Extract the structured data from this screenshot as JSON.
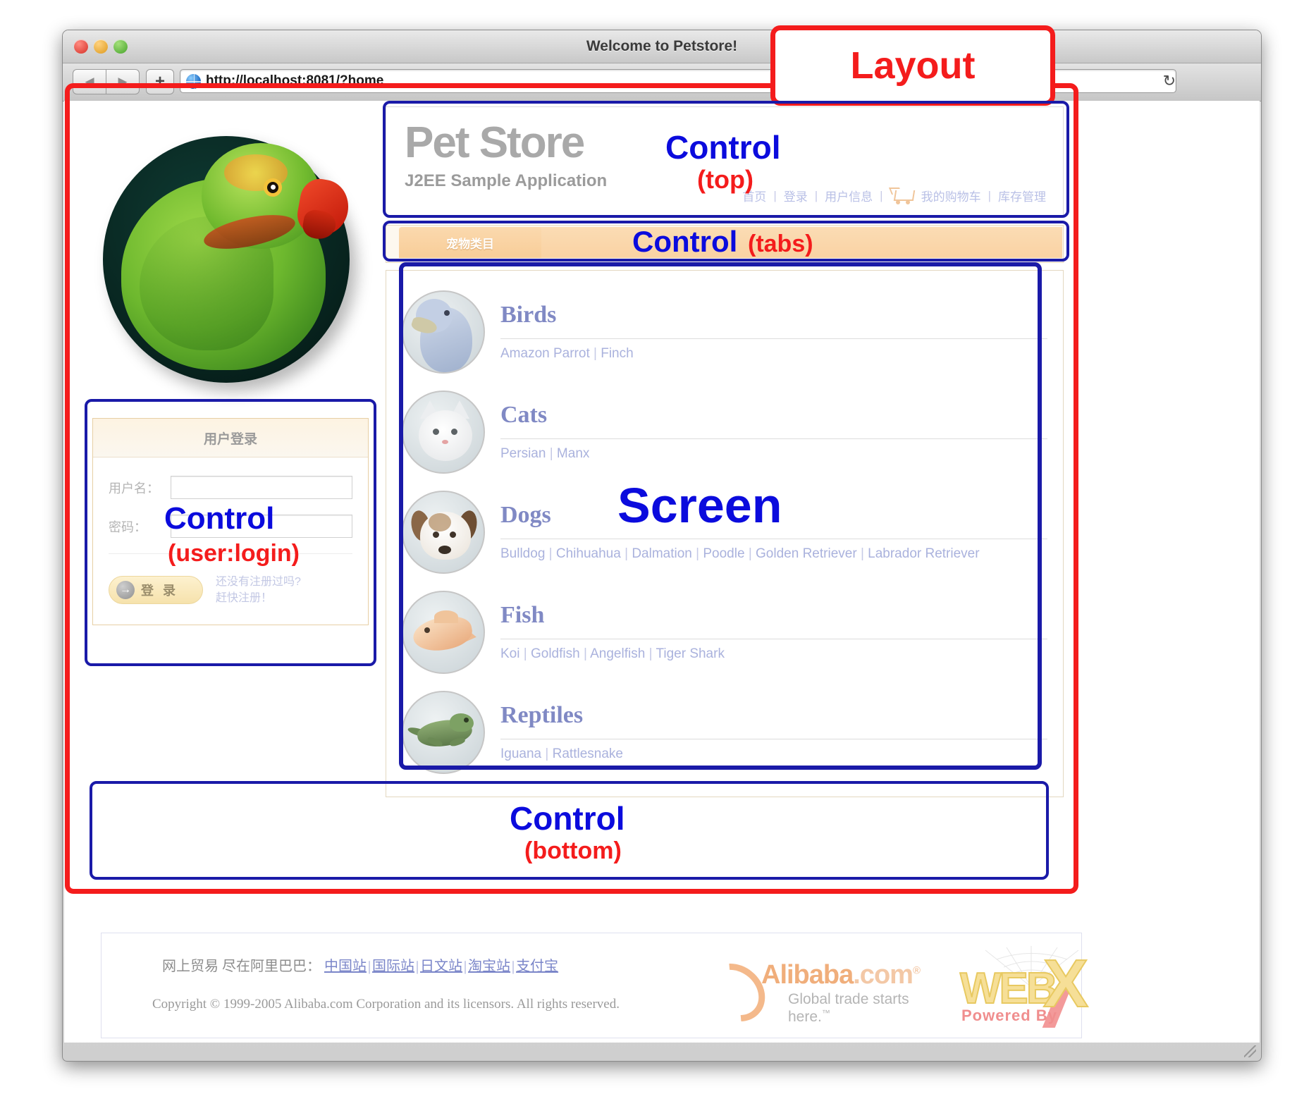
{
  "browser": {
    "window_title": "Welcome to Petstore!",
    "url": "http://localhost:8081/?home",
    "back_icon": "◀",
    "forward_icon": "▶",
    "new_tab_label": "+",
    "reload_icon": "↻"
  },
  "header": {
    "title": "Pet Store",
    "subtitle": "J2EE Sample Application",
    "nav": [
      {
        "label": "首页"
      },
      {
        "label": "登录"
      },
      {
        "label": "用户信息"
      },
      {
        "label": "我的购物车",
        "icon": "cart-icon"
      },
      {
        "label": "库存管理"
      }
    ],
    "separator": "|"
  },
  "tabs": {
    "active_label": "宠物类目"
  },
  "login": {
    "heading": "用户登录",
    "username_label": "用户名：",
    "username_value": "",
    "password_label": "密码：",
    "password_value": "",
    "submit_label": "登 录",
    "submit_icon": "→",
    "register_line1": "还没有注册过吗?",
    "register_line2": "赶快注册！"
  },
  "categories": [
    {
      "name": "Birds",
      "thumb": "bird-thumb",
      "breeds": [
        "Amazon Parrot",
        "Finch"
      ]
    },
    {
      "name": "Cats",
      "thumb": "cat-thumb",
      "breeds": [
        "Persian",
        "Manx"
      ]
    },
    {
      "name": "Dogs",
      "thumb": "dog-thumb",
      "breeds": [
        "Bulldog",
        "Chihuahua",
        "Dalmation",
        "Poodle",
        "Golden Retriever",
        "Labrador Retriever"
      ]
    },
    {
      "name": "Fish",
      "thumb": "fish-thumb",
      "breeds": [
        "Koi",
        "Goldfish",
        "Angelfish",
        "Tiger Shark"
      ]
    },
    {
      "name": "Reptiles",
      "thumb": "reptile-thumb",
      "breeds": [
        "Iguana",
        "Rattlesnake"
      ]
    }
  ],
  "footer": {
    "trade_prefix": "网上贸易 尽在阿里巴巴：",
    "trade_links": [
      "中国站",
      "国际站",
      "日文站",
      "淘宝站",
      "支付宝"
    ],
    "copyright": "Copyright © 1999-2005 Alibaba.com Corporation and its licensors. All rights reserved.",
    "alibaba_name": "Alibaba",
    "alibaba_domain": ".com",
    "alibaba_registered": "®",
    "alibaba_tagline": "Global trade starts here.",
    "alibaba_tm": "™",
    "webx_web": "WEB",
    "webx_x": "X",
    "webx_powered": "Powered By"
  },
  "annotations": {
    "layout": "Layout",
    "screen": "Screen",
    "control": "Control",
    "control_top": "(top)",
    "control_tabs": "(tabs)",
    "control_bottom": "(bottom)",
    "control_user_login": "(user:login)",
    "colors": {
      "annotation_red": "#f41c1c",
      "annotation_blue": "#0b0bdd",
      "box_blue": "#1a1aa8"
    }
  }
}
